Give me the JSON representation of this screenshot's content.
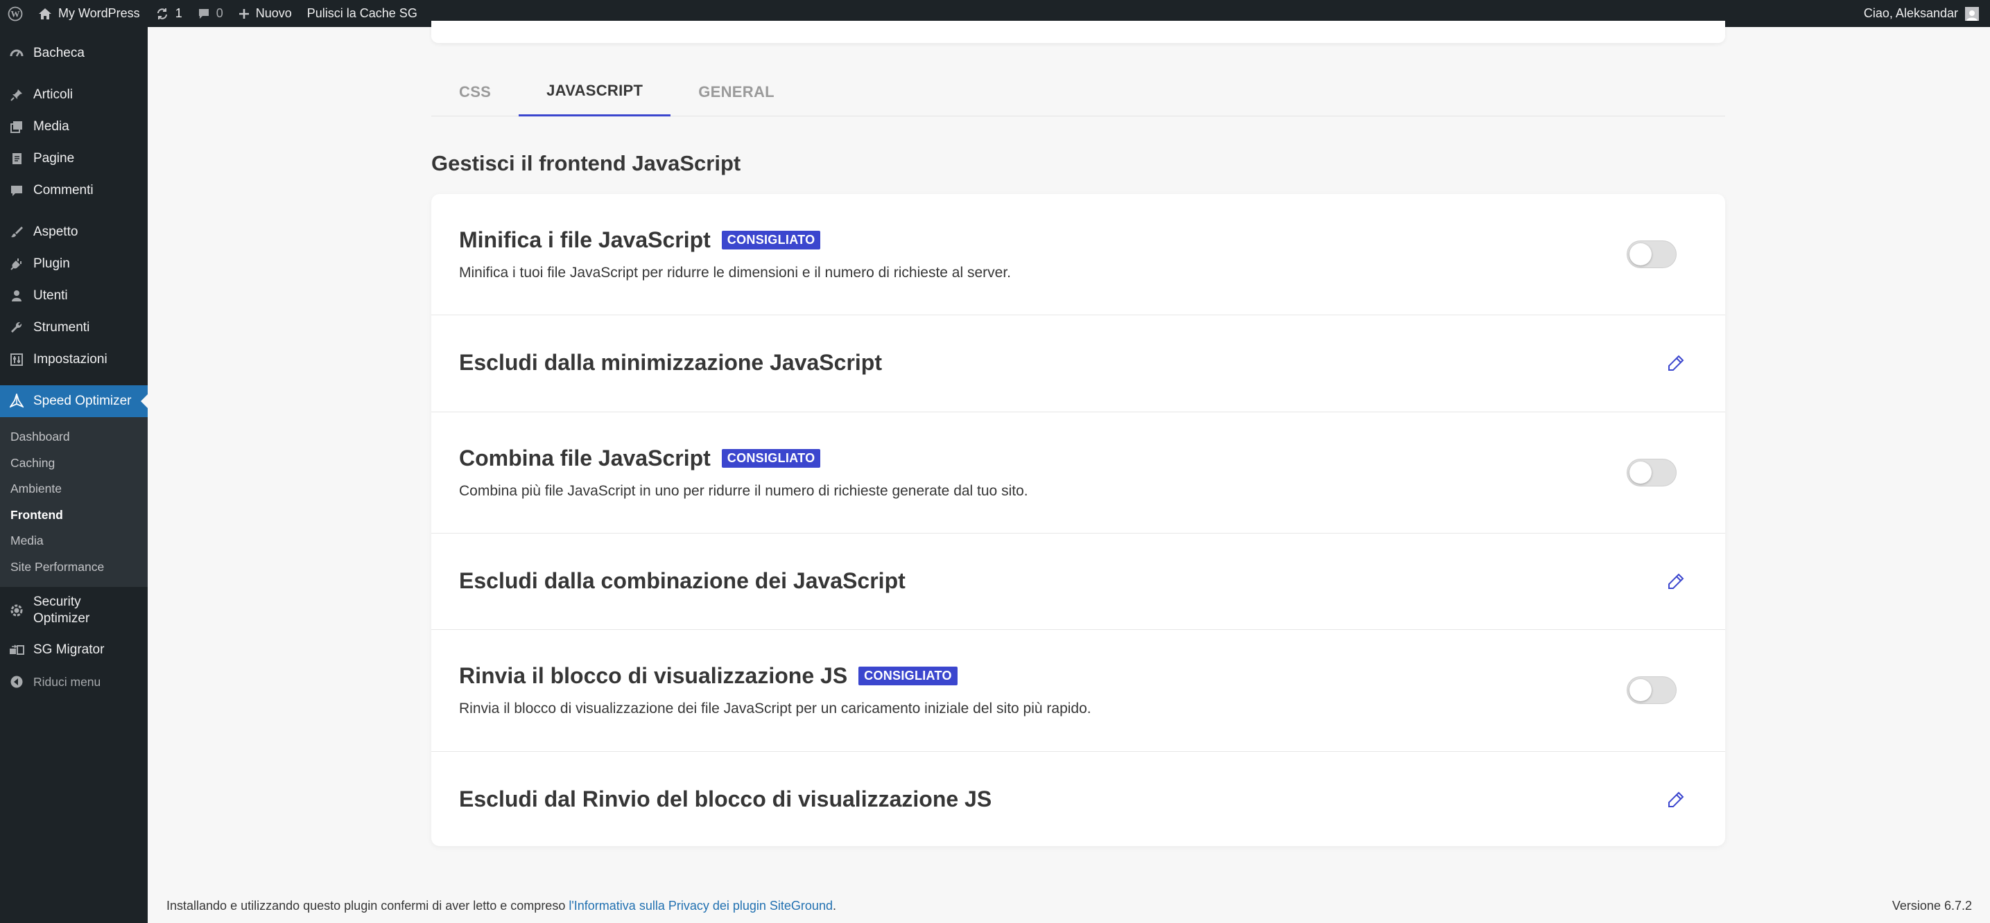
{
  "adminbar": {
    "site_name": "My WordPress",
    "updates_count": "1",
    "comments_count": "0",
    "new_label": "Nuovo",
    "purge_label": "Pulisci la Cache SG",
    "greeting": "Ciao, Aleksandar"
  },
  "sidebar": {
    "items": [
      {
        "label": "Bacheca",
        "icon": "dashboard-icon"
      },
      {
        "label": "Articoli",
        "icon": "pin-icon"
      },
      {
        "label": "Media",
        "icon": "media-icon"
      },
      {
        "label": "Pagine",
        "icon": "page-icon"
      },
      {
        "label": "Commenti",
        "icon": "comment-icon"
      },
      {
        "label": "Aspetto",
        "icon": "brush-icon"
      },
      {
        "label": "Plugin",
        "icon": "plugin-icon"
      },
      {
        "label": "Utenti",
        "icon": "user-icon"
      },
      {
        "label": "Strumenti",
        "icon": "wrench-icon"
      },
      {
        "label": "Impostazioni",
        "icon": "settings-icon"
      },
      {
        "label": "Speed Optimizer",
        "icon": "speed-optimizer-icon"
      }
    ],
    "submenu": [
      "Dashboard",
      "Caching",
      "Ambiente",
      "Frontend",
      "Media",
      "Site Performance"
    ],
    "after": [
      {
        "label_line1": "Security",
        "label_line2": "Optimizer",
        "icon": "gear-shield-icon"
      },
      {
        "label": "SG Migrator",
        "icon": "migrator-icon"
      }
    ],
    "collapse_label": "Riduci menu"
  },
  "tabs": [
    "CSS",
    "JAVASCRIPT",
    "GENERAL"
  ],
  "active_tab": "JAVASCRIPT",
  "section_title": "Gestisci il frontend JavaScript",
  "rows": [
    {
      "title": "Minifica i file JavaScript",
      "badge": "CONSIGLIATO",
      "desc": "Minifica i tuoi file JavaScript per ridurre le dimensioni e il numero di richieste al server.",
      "control": "toggle",
      "enabled": false
    },
    {
      "title": "Escludi dalla minimizzazione JavaScript",
      "control": "edit"
    },
    {
      "title": "Combina file JavaScript",
      "badge": "CONSIGLIATO",
      "desc": "Combina più file JavaScript in uno per ridurre il numero di richieste generate dal tuo sito.",
      "control": "toggle",
      "enabled": false
    },
    {
      "title": "Escludi dalla combinazione dei JavaScript",
      "control": "edit"
    },
    {
      "title": "Rinvia il blocco di visualizzazione JS",
      "badge": "CONSIGLIATO",
      "desc": "Rinvia il blocco di visualizzazione dei file JavaScript per un caricamento iniziale del sito più rapido.",
      "control": "toggle",
      "enabled": false
    },
    {
      "title": "Escludi dal Rinvio del blocco di visualizzazione JS",
      "control": "edit"
    }
  ],
  "footer": {
    "text": "Installando e utilizzando questo plugin confermi di aver letto e compreso ",
    "link": "l'Informativa sulla Privacy dei plugin SiteGround",
    "end": ".",
    "version": "Versione 6.7.2"
  },
  "colors": {
    "accent": "#3b46ce",
    "admin_dark": "#1d2327",
    "wp_blue": "#2271b1"
  }
}
